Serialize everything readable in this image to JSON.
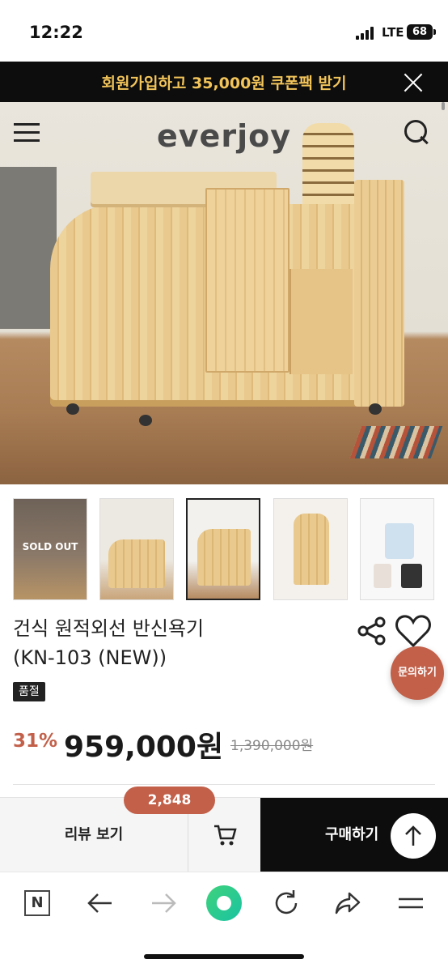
{
  "status_bar": {
    "time": "12:22",
    "network": "LTE",
    "battery": "68"
  },
  "promo": {
    "text": "회원가입하고 35,000원 쿠폰팩 받기"
  },
  "header": {
    "logo": "everjoy"
  },
  "thumbnails": {
    "sold_out_label": "SOLD OUT"
  },
  "product": {
    "title_line1": "건식 원적외선 반신욕기",
    "title_line2": "(KN-103 (NEW))",
    "badge": "품절",
    "discount": "31%",
    "price": "959,000원",
    "original_price": "1,390,000원"
  },
  "floating": {
    "inquiry_label": "문의하기"
  },
  "bottom_bar": {
    "review_label": "리뷰 보기",
    "review_count": "2,848",
    "buy_label": "구매하기"
  },
  "browser_nav": {
    "n_label": "N"
  },
  "colors": {
    "accent": "#c2604a",
    "promo_text": "#f2c45a",
    "dark": "#0d0d0d"
  }
}
